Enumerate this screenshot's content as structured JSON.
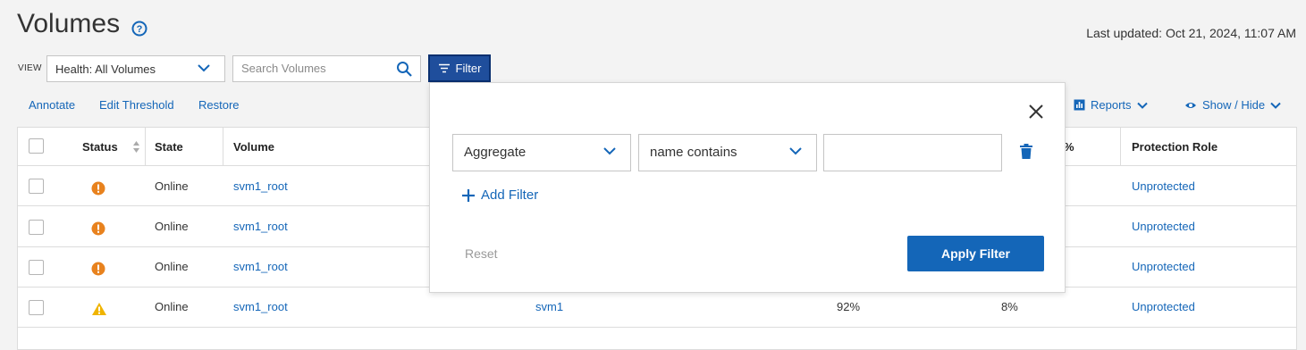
{
  "header": {
    "title": "Volumes",
    "last_updated": "Last updated: Oct 21, 2024, 11:07 AM"
  },
  "toolbar": {
    "view_label": "VIEW",
    "view_value": "Health: All Volumes",
    "search_placeholder": "Search Volumes",
    "filter_label": "Filter"
  },
  "actions": {
    "annotate": "Annotate",
    "edit_threshold": "Edit Threshold",
    "restore": "Restore",
    "reports": "Reports",
    "show_hide": "Show / Hide"
  },
  "table": {
    "headers": {
      "status": "Status",
      "state": "State",
      "volume": "Volume",
      "partial": "%",
      "protection_role": "Protection Role"
    },
    "rows": [
      {
        "status_icon": "error-icon",
        "state": "Online",
        "volume": "svm1_root",
        "protection_role": "Unprotected"
      },
      {
        "status_icon": "error-icon",
        "state": "Online",
        "volume": "svm1_root",
        "protection_role": "Unprotected"
      },
      {
        "status_icon": "error-icon",
        "state": "Online",
        "volume": "svm1_root",
        "protection_role": "Unprotected"
      },
      {
        "status_icon": "warning-icon",
        "state": "Online",
        "volume": "svm1_root",
        "svm": "svm1",
        "col_a": "92%",
        "col_b": "8%",
        "protection_role": "Unprotected"
      }
    ]
  },
  "filter_panel": {
    "field": "Aggregate",
    "operator": "name contains",
    "value": "",
    "add_filter": "Add Filter",
    "reset": "Reset",
    "apply": "Apply Filter"
  },
  "colors": {
    "link": "#1466b8",
    "filter_button": "#1f4e9c",
    "error": "#e8821e",
    "warning": "#f0b400"
  }
}
